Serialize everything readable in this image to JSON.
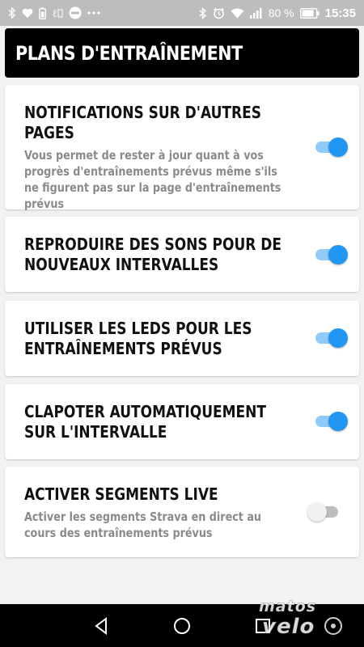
{
  "status_bar": {
    "left_icons": [
      "bluetooth-icon",
      "heart-icon",
      "battery-saver-icon",
      "newspaper-icon",
      "app-badge-icon",
      "more-dots-icon"
    ],
    "right_icons": [
      "bluetooth-icon",
      "alarm-icon",
      "wifi-icon",
      "signal-icon",
      "battery-icon"
    ],
    "battery_percent": "80 %",
    "time": "15:35"
  },
  "header": {
    "title": "PLANS D'ENTRAÎNEMENT"
  },
  "settings": [
    {
      "title": "NOTIFICATIONS SUR D'AUTRES PAGES",
      "description": "Vous permet de rester à jour quant à vos progrès d'entraînements prévus même s'ils ne figurent pas sur la page d'entraînements prévus",
      "enabled": true
    },
    {
      "title": "REPRODUIRE DES SONS POUR DE NOUVEAUX INTERVALLES",
      "description": "",
      "enabled": true
    },
    {
      "title": "UTILISER LES LEDS POUR LES ENTRAÎNEMENTS PRÉVUS",
      "description": "",
      "enabled": true
    },
    {
      "title": "CLAPOTER AUTOMATIQUEMENT SUR L'INTERVALLE",
      "description": "",
      "enabled": true
    },
    {
      "title": "ACTIVER SEGMENTS LIVE",
      "description": "Activer les segments Strava en direct au cours des entraînements prévus",
      "enabled": false
    }
  ],
  "colors": {
    "accent": "#2196f3",
    "accent_track": "#90caf9",
    "header_bg": "#000000",
    "statusbar_bg": "#bdbdbd",
    "page_bg": "#f2f2f2"
  },
  "nav_bar": {
    "buttons": [
      "back-icon",
      "home-icon",
      "recents-icon"
    ]
  },
  "watermark": {
    "text": "matos velo"
  }
}
